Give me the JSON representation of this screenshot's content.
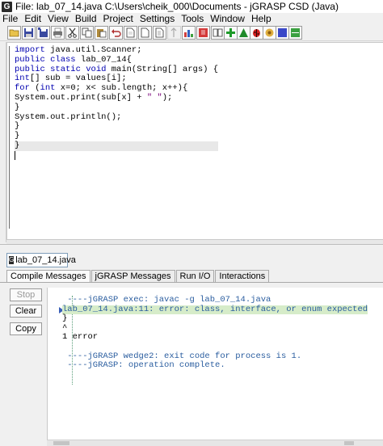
{
  "window": {
    "title": "File: lab_07_14.java  C:\\Users\\cheik_000\\Documents - jGRASP CSD (Java)",
    "logo_letter": "G"
  },
  "menu": [
    {
      "label": "File"
    },
    {
      "label": "Edit"
    },
    {
      "label": "View"
    },
    {
      "label": "Build"
    },
    {
      "label": "Project"
    },
    {
      "label": "Settings"
    },
    {
      "label": "Tools"
    },
    {
      "label": "Window"
    },
    {
      "label": "Help"
    }
  ],
  "toolbar": {
    "buttons": [
      "open-folder-icon",
      "save-icon",
      "save-all-icon",
      "print-icon",
      "cut-icon",
      "copy-icon",
      "paste-icon",
      "undo-icon",
      "new-file-icon",
      "generic-file-icon",
      "file-alt-icon",
      "generate-csd-icon",
      "remove-csd-icon",
      "browse-icon",
      "compile-icon",
      "run-icon",
      "debug-icon",
      "ladybug-icon",
      "stop-icon",
      "panel-icon"
    ]
  },
  "editor": {
    "code_lines": [
      [
        {
          "t": "import",
          "k": "kw"
        },
        {
          "t": " java.util.Scanner;"
        }
      ],
      [
        {
          "t": "public class",
          "k": "kw"
        },
        {
          "t": " lab_07_14{"
        }
      ],
      [
        {
          "t": "public static void",
          "k": "kw"
        },
        {
          "t": " main(String[] args) {"
        }
      ],
      [
        {
          "t": "int",
          "k": "kw"
        },
        {
          "t": "[] sub = values[i];"
        }
      ],
      [
        {
          "t": "for",
          "k": "kw"
        },
        {
          "t": " ("
        },
        {
          "t": "int",
          "k": "kw"
        },
        {
          "t": " x=0; x< sub.length; x++){"
        }
      ],
      [
        {
          "t": "System.out.print(sub[x] + "
        },
        {
          "t": "\" \"",
          "k": "str"
        },
        {
          "t": ");"
        }
      ],
      [
        {
          "t": "}"
        }
      ],
      [
        {
          "t": "System.out.println();"
        }
      ],
      [
        {
          "t": "}"
        }
      ],
      [
        {
          "t": "}"
        }
      ],
      [
        {
          "t": "}"
        }
      ],
      [
        {
          "t": ""
        }
      ]
    ]
  },
  "document_tab": {
    "label": "lab_07_14.java",
    "logo_letter": "G"
  },
  "message_tabs": [
    {
      "label": "Compile Messages",
      "active": true
    },
    {
      "label": "jGRASP Messages",
      "active": false
    },
    {
      "label": "Run I/O",
      "active": false
    },
    {
      "label": "Interactions",
      "active": false
    }
  ],
  "side_buttons": {
    "stop": "Stop",
    "clear": "Clear",
    "copy": "Copy"
  },
  "output": {
    "lines": [
      {
        "text": " ----jGRASP exec: javac -g lab_07_14.java",
        "style": "blue"
      },
      {
        "text": "lab_07_14.java:11: error: class, interface, or enum expected",
        "style": "err"
      },
      {
        "text": "}",
        "style": "black"
      },
      {
        "text": "^",
        "style": "black"
      },
      {
        "text": "1 error",
        "style": "black"
      },
      {
        "text": "",
        "style": "black"
      },
      {
        "text": " ----jGRASP wedge2: exit code for process is 1.",
        "style": "blue"
      },
      {
        "text": " ----jGRASP: operation complete.",
        "style": "blue"
      }
    ]
  }
}
